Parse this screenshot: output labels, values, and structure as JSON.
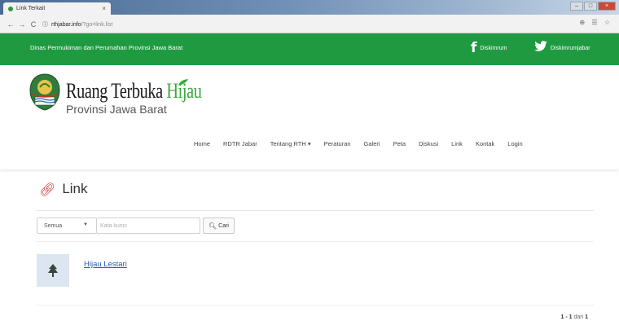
{
  "browser": {
    "tab_title": "Link Terkait",
    "tab_close": "×",
    "url_host": "rthjabar.info",
    "url_path": "/?go=link.list",
    "nav_back": "←",
    "nav_forward": "→",
    "nav_reload": "C",
    "info_icon": "ⓘ",
    "addr_icons": "⊕ ☰ ☆",
    "win_min": "–",
    "win_max": "□",
    "win_close": "×"
  },
  "site": {
    "org_name": "Dinas Permukiman dan Perumahan Provinsi Jawa Barat",
    "facebook_label": "Diskimrum",
    "twitter_label": "Diskimrumjabar",
    "brand_title_a": "Ruang Terbuka ",
    "brand_title_b": "Hijau",
    "brand_subtitle": "Provinsi Jawa Barat",
    "brand_color": "#1f9a41"
  },
  "nav": {
    "items": [
      "Home",
      "RDTR Jabar",
      "Tentang RTH ▾",
      "Peraturan",
      "Galeri",
      "Peta",
      "Diskusi",
      "Link",
      "Kontak",
      "Login"
    ]
  },
  "page": {
    "title": "Link",
    "filter_select": "Semua",
    "search_placeholder": "Kata kunci",
    "search_button": "Cari",
    "results": [
      {
        "title": "Hijau Lestari"
      }
    ],
    "pagination_range": "1 - 1",
    "pagination_of": " dari ",
    "pagination_total": "1"
  }
}
